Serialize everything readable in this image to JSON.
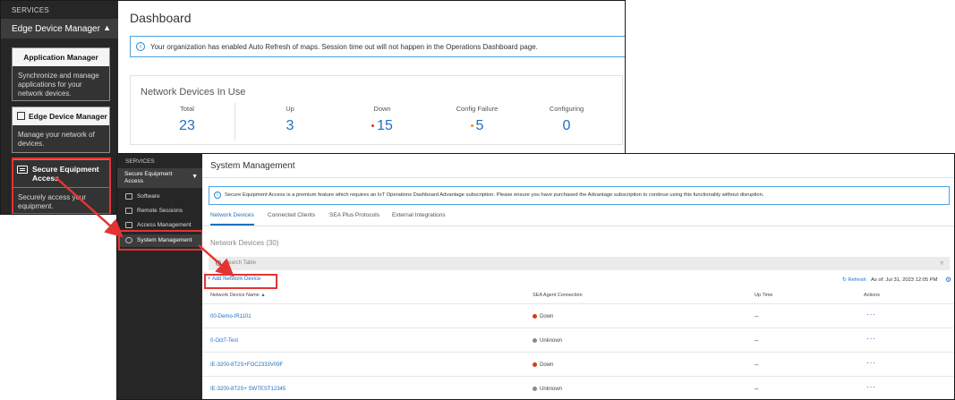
{
  "back_window": {
    "sidebar": {
      "services_label": "SERVICES",
      "section_title": "Edge Device Manager",
      "cards": [
        {
          "title": "Application Manager",
          "desc": "Synchronize and manage applications for your network devices."
        },
        {
          "title": "Edge Device Manager",
          "desc": "Manage your network of devices."
        },
        {
          "title": "Secure Equipment Access",
          "desc": "Securely access your equipment."
        }
      ]
    },
    "main": {
      "title": "Dashboard",
      "banner": "Your organization has enabled Auto Refresh of maps. Session time out will not happen in the Operations Dashboard page.",
      "network_devices": {
        "title": "Network Devices In Use",
        "stats": [
          {
            "label": "Total",
            "value": "23"
          },
          {
            "label": "Up",
            "value": "3"
          },
          {
            "label": "Down",
            "value": "15",
            "dot_color": "#d9381e"
          },
          {
            "label": "Config Failure",
            "value": "5",
            "dot_color": "#e8912d"
          },
          {
            "label": "Configuring",
            "value": "0"
          }
        ]
      }
    }
  },
  "front_window": {
    "sidebar": {
      "services_label": "SERVICES",
      "section_title_line1": "Secure Equipment",
      "section_title_line2": "Access",
      "items": [
        {
          "label": "Software",
          "icon": "wrench-icon"
        },
        {
          "label": "Remote Sessions",
          "icon": "monitor-icon"
        },
        {
          "label": "Access Management",
          "icon": "lock-icon"
        },
        {
          "label": "System Management",
          "icon": "gear-icon"
        }
      ]
    },
    "main": {
      "title": "System Management",
      "banner": "Secure Equipment Access is a premium feature which requires an IoT Operations Dashboard Advantage subscription. Please ensure you have purchased the Advantage subscription to continue using this functionality without disruption.",
      "tabs": [
        "Network Devices",
        "Connected Clients",
        "SEA Plus Protocols",
        "External Integrations"
      ],
      "device_count_label": "Network Devices (30)",
      "search_placeholder": "Search Table",
      "add_button": "Add Network Device",
      "refresh_label": "Refresh",
      "as_of": "As of: Jul 31, 2023 12:05 PM",
      "columns": [
        "Network Device Name",
        "SEA Agent Connection",
        "Up Time",
        "Actions"
      ],
      "rows": [
        {
          "name": "00-Demo-IR1101",
          "status": "Down",
          "status_color": "#d9381e",
          "uptime": "–",
          "actions": "···"
        },
        {
          "name": "0-Oct7-Test",
          "status": "Unknown",
          "status_color": "#8a8a8a",
          "uptime": "–",
          "actions": "···"
        },
        {
          "name": "IE-3200-8T2S+FOC2333V09F",
          "status": "Down",
          "status_color": "#d9381e",
          "uptime": "–",
          "actions": "···"
        },
        {
          "name": "IE-3200-8T2S+ SWTEST12345",
          "status": "Unknown",
          "status_color": "#8a8a8a",
          "uptime": "–",
          "actions": "···"
        }
      ]
    }
  },
  "colors": {
    "highlight": "#e53333",
    "link": "#1d70c2",
    "sidebar_bg": "#262626"
  }
}
